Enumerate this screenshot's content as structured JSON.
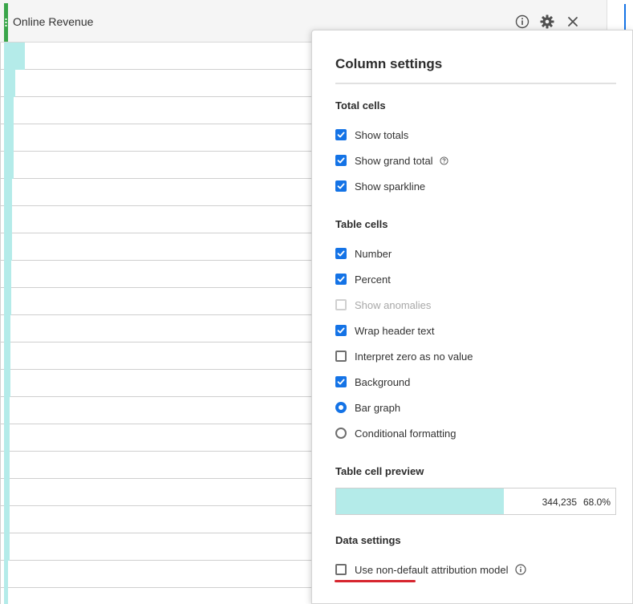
{
  "column": {
    "title": "Online Revenue",
    "icons": {
      "info": "info-icon",
      "settings": "gear-icon",
      "close": "close-icon"
    }
  },
  "table": {
    "row_bar_fractions": [
      0.2,
      0.11,
      0.09,
      0.09,
      0.09,
      0.08,
      0.08,
      0.08,
      0.07,
      0.07,
      0.06,
      0.06,
      0.06,
      0.05,
      0.05,
      0.05,
      0.05,
      0.05,
      0.05,
      0.04,
      0.04
    ]
  },
  "settings": {
    "title": "Column settings",
    "total_cells": {
      "heading": "Total cells",
      "show_totals": {
        "label": "Show totals",
        "checked": true
      },
      "show_grand_total": {
        "label": "Show grand total",
        "checked": true
      },
      "show_sparkline": {
        "label": "Show sparkline",
        "checked": true
      }
    },
    "table_cells": {
      "heading": "Table cells",
      "number": {
        "label": "Number",
        "checked": true
      },
      "percent": {
        "label": "Percent",
        "checked": true
      },
      "show_anomalies": {
        "label": "Show anomalies",
        "checked": false,
        "disabled": true
      },
      "wrap_header": {
        "label": "Wrap header text",
        "checked": true
      },
      "interpret_zero": {
        "label": "Interpret zero as no value",
        "checked": false
      },
      "background": {
        "label": "Background",
        "checked": true
      },
      "bar_graph": {
        "label": "Bar graph",
        "selected": true
      },
      "conditional": {
        "label": "Conditional formatting",
        "selected": false
      }
    },
    "preview": {
      "heading": "Table cell preview",
      "value": "344,235",
      "percent": "68.0%",
      "bar_fraction": 0.6
    },
    "data_settings": {
      "heading": "Data settings",
      "attribution": {
        "label": "Use non-default attribution model",
        "checked": false
      }
    }
  },
  "colors": {
    "accent": "#1473e6",
    "bar": "#b4ebe9",
    "drag_handle": "#3aa54a",
    "annotation": "#d7262f"
  }
}
